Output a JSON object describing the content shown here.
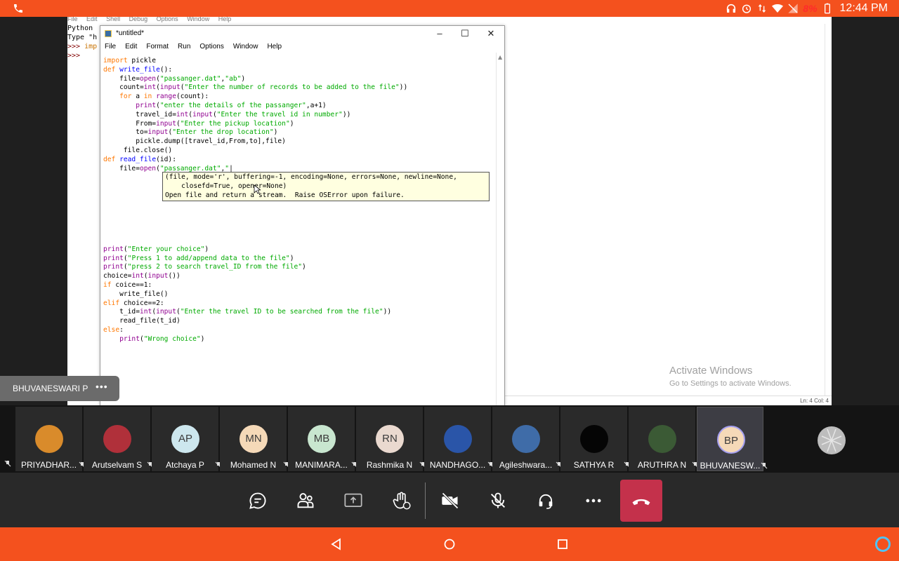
{
  "status_bar": {
    "battery_pct": "8%",
    "time": "12:44 PM"
  },
  "python_shell": {
    "menu": [
      "File",
      "Edit",
      "Shell",
      "Debug",
      "Options",
      "Window",
      "Help"
    ],
    "line1": "Python",
    "line2_prefix": "Type \"h",
    "line3_prompt": ">>> ",
    "line3_text": "imp",
    "line4_prompt": ">>>",
    "status": "Ln: 4   Col: 4"
  },
  "watermark": {
    "line1": "Activate Windows",
    "line2": "Go to Settings to activate Windows."
  },
  "editor": {
    "title": "*untitled*",
    "menu": [
      "File",
      "Edit",
      "Format",
      "Run",
      "Options",
      "Window",
      "Help"
    ],
    "calltip_line1": "(file, mode='r', buffering=-1, encoding=None, errors=None, newline=None,",
    "calltip_line2": "    closefd=True, opener=None)",
    "calltip_line3": "Open file and return a stream.  Raise OSError upon failure."
  },
  "presenter_tag": {
    "name": "BHUVANESWARI P",
    "more": "•••"
  },
  "participants": [
    {
      "name": "PRIYADHAR...",
      "initials": "",
      "color": "#d98b2b",
      "photo": true
    },
    {
      "name": "Arutselvam S",
      "initials": "",
      "color": "#b0303a",
      "photo": true
    },
    {
      "name": "Atchaya P",
      "initials": "AP",
      "color": "#cde7ee",
      "photo": false
    },
    {
      "name": "Mohamed N",
      "initials": "MN",
      "color": "#f5d9b8",
      "photo": false
    },
    {
      "name": "MANIMARA...",
      "initials": "MB",
      "color": "#c8e6cf",
      "photo": false
    },
    {
      "name": "Rashmika N",
      "initials": "RN",
      "color": "#ead9cf",
      "photo": false
    },
    {
      "name": "NANDHAGO...",
      "initials": "",
      "color": "#2a55a8",
      "photo": true
    },
    {
      "name": "Agileshwara...",
      "initials": "",
      "color": "#3f6ca8",
      "photo": true
    },
    {
      "name": "SATHYA R",
      "initials": "",
      "color": "#050505",
      "photo": true
    },
    {
      "name": "ARUTHRA N",
      "initials": "",
      "color": "#3b5a35",
      "photo": true
    },
    {
      "name": "BHUVANESW...",
      "initials": "BP",
      "color": "#f5d9b8",
      "photo": false
    }
  ],
  "controls": [
    "chat-icon",
    "people-icon",
    "share-screen-icon",
    "raise-hand-icon",
    "camera-off-icon",
    "mic-off-icon",
    "audio-icon",
    "more-icon",
    "hang-up-icon"
  ],
  "colors": {
    "accent": "#f4511e",
    "hangup": "#c4314b"
  }
}
